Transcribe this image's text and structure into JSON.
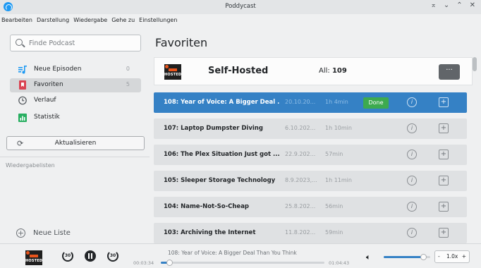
{
  "window": {
    "title": "Poddycast",
    "controls": [
      "⌅",
      "⌄",
      "⌃",
      "✕"
    ]
  },
  "menu": [
    "Bearbeiten",
    "Darstellung",
    "Wiedergabe",
    "Gehe zu",
    "Einstellungen"
  ],
  "sidebar": {
    "search_placeholder": "Finde Podcast",
    "items": [
      {
        "label": "Neue Episoden",
        "count": "0",
        "icon": "new-episodes-icon",
        "color": "#1d99f3"
      },
      {
        "label": "Favoriten",
        "count": "5",
        "icon": "bookmark-icon",
        "color": "#da4453",
        "active": true
      },
      {
        "label": "Verlauf",
        "count": "",
        "icon": "clock-icon",
        "color": "#4d5257"
      },
      {
        "label": "Statistik",
        "count": "",
        "icon": "stats-icon",
        "color": "#27ae60"
      }
    ],
    "refresh_label": "Aktualisieren",
    "playlists_label": "Wiedergabelisten",
    "new_list_label": "Neue Liste"
  },
  "content": {
    "title": "Favoriten",
    "podcast": {
      "name": "Self-Hosted",
      "cover_text": "HOSTED",
      "all_label": "All:",
      "all_count": "109",
      "menu_label": "···"
    },
    "episodes": [
      {
        "title": "108: Year of Voice: A Bigger Deal ...",
        "date": "20.10.20...",
        "duration": "1h 4min",
        "done": "Done",
        "selected": true
      },
      {
        "title": "107: Laptop Dumpster Diving",
        "date": "6.10.202...",
        "duration": "1h 10min",
        "done": ""
      },
      {
        "title": "106: The Plex Situation Just got ...",
        "date": "22.9.202...",
        "duration": "57min",
        "done": ""
      },
      {
        "title": "105: Sleeper Storage Technology",
        "date": "8.9.2023,...",
        "duration": "1h 11min",
        "done": ""
      },
      {
        "title": "104: Name-Not-So-Cheap",
        "date": "25.8.202...",
        "duration": "56min",
        "done": ""
      },
      {
        "title": "103: Archiving the Internet",
        "date": "11.8.202...",
        "duration": "59min",
        "done": ""
      }
    ]
  },
  "player": {
    "now_playing": "108: Year of Voice: A Bigger Deal Than You Think",
    "cover_text": "HOSTED",
    "elapsed": "00:03:34",
    "remaining": "01:04:43",
    "progress_fraction": 0.05,
    "volume_fraction": 0.85,
    "skip_back_label": "30",
    "skip_fwd_label": "30",
    "speed": {
      "minus": "-",
      "value": "1.0x",
      "plus": "+"
    }
  },
  "colors": {
    "accent": "#3581c5",
    "done": "#3daa4f",
    "brand": "#e8541c"
  }
}
